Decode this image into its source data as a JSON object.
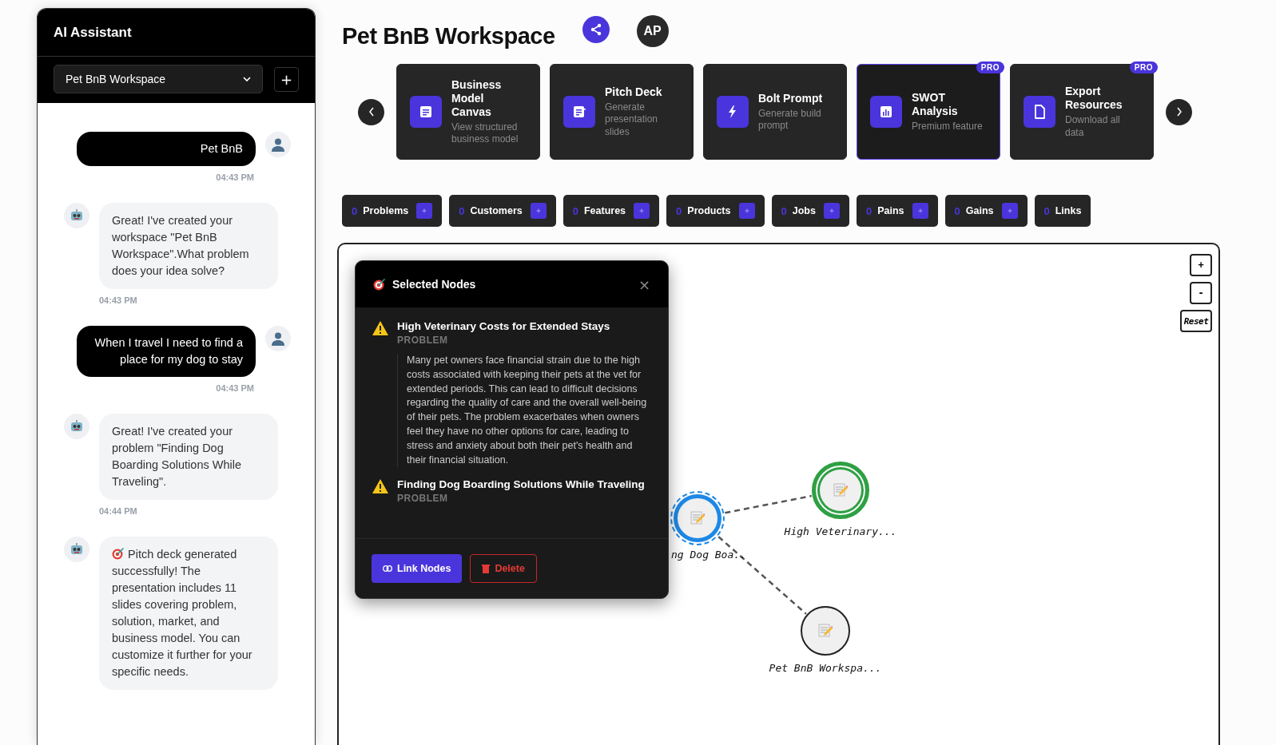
{
  "sidebar": {
    "title": "AI Assistant",
    "workspace_select": {
      "value": "Pet BnB Workspace"
    },
    "add_button": "+",
    "messages": [
      {
        "kind": "user",
        "text": "Pet BnB",
        "time": "04:43 PM"
      },
      {
        "kind": "assistant",
        "text": "Great! I've created your workspace \"Pet BnB Workspace\".What problem does your idea solve?",
        "time": "04:43 PM"
      },
      {
        "kind": "user",
        "text": "When I travel I need to find a place for my dog to stay",
        "time": "04:43 PM"
      },
      {
        "kind": "assistant",
        "text": "Great! I've created your problem \"Finding Dog Boarding Solutions While Traveling\".",
        "time": "04:44 PM"
      },
      {
        "kind": "result",
        "text": "Pitch deck generated successfully! The presentation includes 11 slides covering problem, solution, market, and business model. You can customize it further for your specific needs."
      }
    ]
  },
  "header": {
    "title": "Pet BnB Workspace",
    "avatar": "AP"
  },
  "tool_cards": [
    {
      "title": "Business Model Canvas",
      "subtitle": "View structured business model",
      "selected": false
    },
    {
      "title": "Pitch Deck",
      "subtitle": "Generate presentation slides",
      "selected": false
    },
    {
      "title": "Bolt Prompt",
      "subtitle": "Generate build prompt",
      "selected": false
    },
    {
      "title": "SWOT Analysis",
      "subtitle": "Premium feature",
      "badge": "PRO",
      "selected": true
    },
    {
      "title": "Export Resources",
      "subtitle": "Download all data",
      "badge": "PRO",
      "selected": false
    }
  ],
  "chips": [
    {
      "count": "0",
      "label": "Problems",
      "add_button": true
    },
    {
      "count": "0",
      "label": "Customers",
      "add_button": true
    },
    {
      "count": "0",
      "label": "Features",
      "add_button": true
    },
    {
      "count": "0",
      "label": "Products",
      "add_button": true
    },
    {
      "count": "0",
      "label": "Jobs",
      "add_button": true
    },
    {
      "count": "0",
      "label": "Pains",
      "add_button": true
    },
    {
      "count": "0",
      "label": "Gains",
      "add_button": true
    },
    {
      "count": "0",
      "label": "Links",
      "add_button": false
    }
  ],
  "canvas": {
    "zoom_controls": [
      "+",
      "-",
      "Reset"
    ],
    "nodes": [
      {
        "label": "ng Dog Boa..",
        "color": "#1e88e5",
        "kind": "focused"
      },
      {
        "label": "High Veterinary...",
        "color": "#2ea043",
        "kind": "selected"
      },
      {
        "label": "Pet BnB Workspa...",
        "color": "#222222",
        "kind": "plain"
      }
    ],
    "popup": {
      "title": "Selected Nodes",
      "close": "×",
      "items": [
        {
          "title": "High Veterinary Costs for Extended Stays",
          "type": "PROBLEM",
          "description": "Many pet owners face financial strain due to the high costs associated with keeping their pets at the vet for extended periods. This can lead to difficult decisions regarding the quality of care and the overall well-being of their pets. The problem exacerbates when owners feel they have no other options for care, leading to stress and anxiety about both their pet's health and their financial situation."
        },
        {
          "title": "Finding Dog Boarding Solutions While Traveling",
          "type": "PROBLEM"
        }
      ],
      "buttons": [
        {
          "label": "Link Nodes",
          "kind": "primary"
        },
        {
          "label": "Delete",
          "kind": "danger"
        }
      ]
    }
  }
}
